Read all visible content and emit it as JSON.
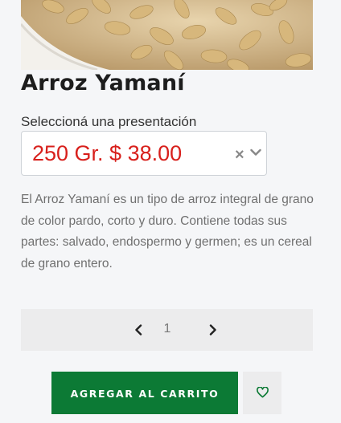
{
  "product": {
    "image_alt": "Arroz Yamaní",
    "title": "Arroz Yamaní",
    "select_label": "Seleccioná una presentación",
    "selected_option": "250 Gr. $ 38.00",
    "clear_symbol": "×",
    "description": "El Arroz Yamaní es un tipo de arroz integral de grano de color pardo, corto y duro.  Contiene todas sus partes: salvado, endospermo y germen; es un cereal de grano entero."
  },
  "pager": {
    "current_page": "1"
  },
  "actions": {
    "add_to_cart_label": "AGREGAR AL CARRITO"
  },
  "colors": {
    "price": "#d8201c",
    "primary_button": "#0c7a35"
  },
  "icons": {
    "clear": "close-icon",
    "dropdown": "chevron-down-icon",
    "prev": "chevron-left-icon",
    "next": "chevron-right-icon",
    "wishlist": "heart-icon"
  }
}
